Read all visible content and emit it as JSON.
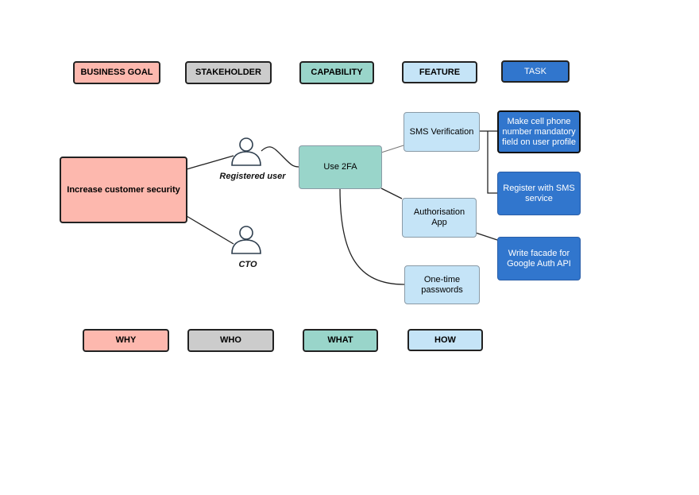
{
  "legend_top": [
    {
      "label": "BUSINESS GOAL",
      "color": "#fdb8ae"
    },
    {
      "label": "STAKEHOLDER",
      "color": "#cccccc"
    },
    {
      "label": "CAPABILITY",
      "color": "#99d5ca"
    },
    {
      "label": "FEATURE",
      "color": "#c5e4f7"
    },
    {
      "label": "TASK",
      "color": "#3176cd"
    }
  ],
  "legend_bottom": [
    {
      "label": "WHY"
    },
    {
      "label": "WHO"
    },
    {
      "label": "WHAT"
    },
    {
      "label": "HOW"
    }
  ],
  "goal": "Increase customer security",
  "stakeholders": [
    "Registered user",
    "CTO"
  ],
  "stakeholder_icon": "person-icon",
  "capability": "Use 2FA",
  "features": [
    "SMS Verification",
    "Authorisation App",
    "One-time passwords"
  ],
  "tasks": [
    "Make cell phone number mandatory field on user profile",
    "Register with SMS service",
    "Write facade for Google Auth API"
  ]
}
